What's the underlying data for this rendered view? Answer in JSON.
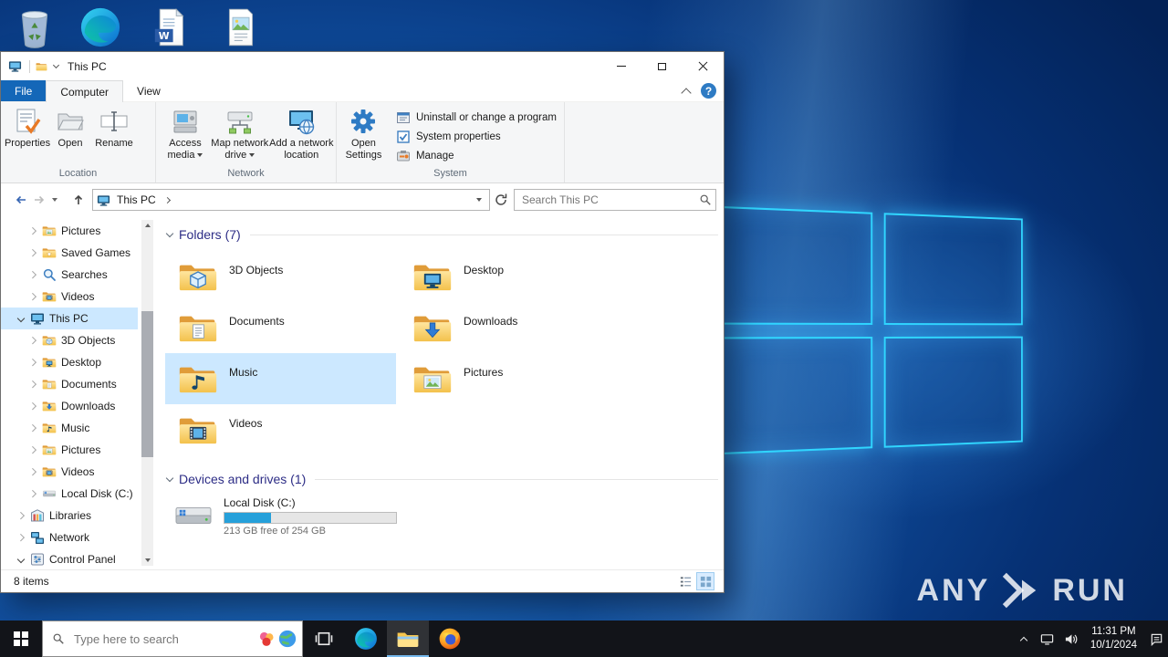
{
  "glyphs": {
    "help": "?"
  },
  "desktop": {
    "watermark_any": "ANY",
    "watermark_run": "RUN"
  },
  "explorer": {
    "titlebar": {
      "title": "This PC"
    },
    "tabs": {
      "file": "File",
      "computer": "Computer",
      "view": "View"
    },
    "ribbon": {
      "properties": "Properties",
      "open": "Open",
      "rename": "Rename",
      "group_location": "Location",
      "access_media": "Access media",
      "map_network_drive": "Map network drive",
      "add_network_location": "Add a network location",
      "group_network": "Network",
      "open_settings": "Open Settings",
      "uninstall": "Uninstall or change a program",
      "system_properties": "System properties",
      "manage": "Manage",
      "group_system": "System"
    },
    "address": {
      "location": "This PC",
      "search_placeholder": "Search This PC"
    },
    "nav": {
      "items": [
        {
          "label": "Pictures",
          "icon": "pictures",
          "indent": 2,
          "arrow": "right"
        },
        {
          "label": "Saved Games",
          "icon": "saved-games",
          "indent": 2,
          "arrow": "right"
        },
        {
          "label": "Searches",
          "icon": "search",
          "indent": 2,
          "arrow": "right"
        },
        {
          "label": "Videos",
          "icon": "videos",
          "indent": 2,
          "arrow": "right"
        },
        {
          "label": "This PC",
          "icon": "pc",
          "indent": 1,
          "arrow": "down",
          "selected": true
        },
        {
          "label": "3D Objects",
          "icon": "objects3d",
          "indent": 2,
          "arrow": "right"
        },
        {
          "label": "Desktop",
          "icon": "desktop",
          "indent": 2,
          "arrow": "right"
        },
        {
          "label": "Documents",
          "icon": "documents",
          "indent": 2,
          "arrow": "right"
        },
        {
          "label": "Downloads",
          "icon": "downloads",
          "indent": 2,
          "arrow": "right"
        },
        {
          "label": "Music",
          "icon": "music",
          "indent": 2,
          "arrow": "right"
        },
        {
          "label": "Pictures",
          "icon": "pictures",
          "indent": 2,
          "arrow": "right"
        },
        {
          "label": "Videos",
          "icon": "videos",
          "indent": 2,
          "arrow": "right"
        },
        {
          "label": "Local Disk (C:)",
          "icon": "drive",
          "indent": 2,
          "arrow": "right"
        },
        {
          "label": "Libraries",
          "icon": "libraries",
          "indent": 1,
          "arrow": "right"
        },
        {
          "label": "Network",
          "icon": "network",
          "indent": 1,
          "arrow": "right"
        },
        {
          "label": "Control Panel",
          "icon": "control-panel",
          "indent": 1,
          "arrow": "down"
        }
      ]
    },
    "content": {
      "folders_header": "Folders (7)",
      "folders": [
        {
          "label": "3D Objects",
          "icon": "objects3d"
        },
        {
          "label": "Desktop",
          "icon": "desktop"
        },
        {
          "label": "Documents",
          "icon": "documents"
        },
        {
          "label": "Downloads",
          "icon": "downloads"
        },
        {
          "label": "Music",
          "icon": "music",
          "selected": true
        },
        {
          "label": "Pictures",
          "icon": "pictures"
        },
        {
          "label": "Videos",
          "icon": "videos"
        }
      ],
      "devices_header": "Devices and drives (1)",
      "drive": {
        "label": "Local Disk (C:)",
        "capacity_text": "213 GB free of 254 GB",
        "used_percent": 27
      }
    },
    "statusbar": {
      "items_count": "8 items"
    }
  },
  "taskbar": {
    "search_placeholder": "Type here to search",
    "time": "11:31 PM",
    "date": "10/1/2024"
  }
}
